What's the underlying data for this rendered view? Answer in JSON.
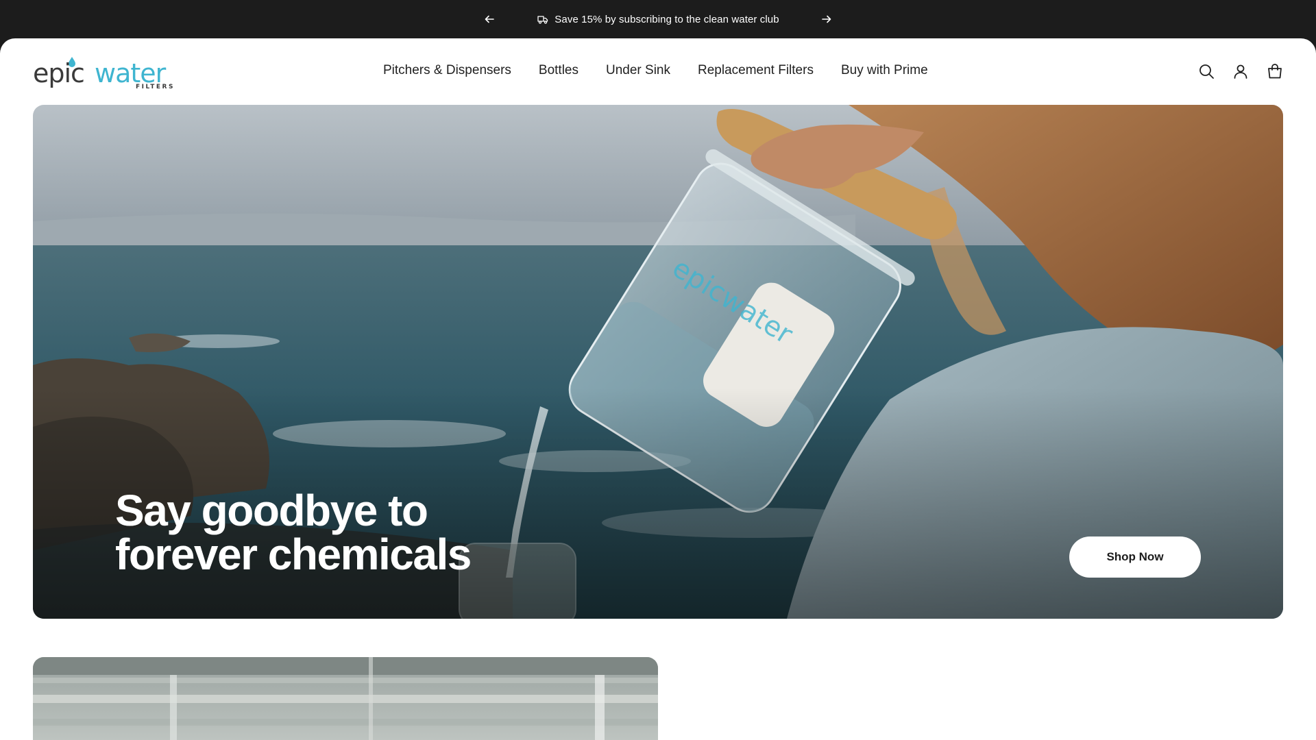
{
  "announcement": {
    "message": "Save 15% by subscribing to the clean water club",
    "prev_icon": "arrow-left-icon",
    "next_icon": "arrow-right-icon",
    "leading_icon": "truck-icon"
  },
  "brand": {
    "logo_text": "epicwater",
    "logo_sub": "FILTERS",
    "accent": "#3fb5d0",
    "dark": "#3a3a3a"
  },
  "nav": {
    "items": [
      {
        "label": "Pitchers & Dispensers"
      },
      {
        "label": "Bottles"
      },
      {
        "label": "Under Sink"
      },
      {
        "label": "Replacement Filters"
      },
      {
        "label": "Buy with Prime"
      }
    ]
  },
  "tools": {
    "search_icon": "search-icon",
    "account_icon": "user-icon",
    "cart_icon": "shopping-bag-icon"
  },
  "hero": {
    "heading_line1": "Say goodbye to",
    "heading_line2": "forever chemicals",
    "cta_label": "Shop Now"
  }
}
